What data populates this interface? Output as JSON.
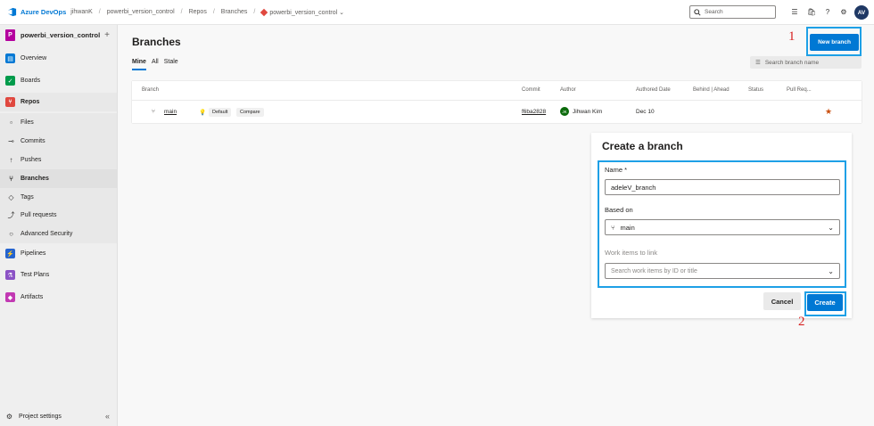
{
  "topbar": {
    "brand": "Azure DevOps",
    "org": "jihwanK",
    "project": "powerbi_version_control",
    "repos": "Repos",
    "branches": "Branches",
    "repo_name": "powerbi_version_control",
    "search_placeholder": "Search",
    "avatar_initials": "AV"
  },
  "sidebar": {
    "project_badge": "P",
    "project_name": "powerbi_version_control",
    "items": [
      {
        "label": "Overview"
      },
      {
        "label": "Boards"
      },
      {
        "label": "Repos"
      },
      {
        "label": "Files"
      },
      {
        "label": "Commits"
      },
      {
        "label": "Pushes"
      },
      {
        "label": "Branches"
      },
      {
        "label": "Tags"
      },
      {
        "label": "Pull requests"
      },
      {
        "label": "Advanced Security"
      },
      {
        "label": "Pipelines"
      },
      {
        "label": "Test Plans"
      },
      {
        "label": "Artifacts"
      }
    ],
    "settings_label": "Project settings"
  },
  "main": {
    "title": "Branches",
    "tabs": [
      "Mine",
      "All",
      "Stale"
    ],
    "filter_placeholder": "Search branch name",
    "new_branch_label": "New branch",
    "annotation_1": "1",
    "annotation_2": "2",
    "table": {
      "columns": [
        "Branch",
        "Commit",
        "Author",
        "Authored Date",
        "Behind | Ahead",
        "Status",
        "Pull Req..."
      ],
      "rows": [
        {
          "branch": "main",
          "default_tag": "Default",
          "compare_tag": "Compare",
          "commit": "f6ba2828",
          "author": "Jihwan Kim",
          "author_initials": "JK",
          "date": "Dec 10"
        }
      ]
    }
  },
  "create_branch": {
    "title": "Create a branch",
    "name_label": "Name *",
    "name_value": "adeleV_branch",
    "based_on_label": "Based on",
    "based_on_value": "main",
    "work_items_label": "Work items to link",
    "work_items_placeholder": "Search work items by ID or title",
    "cancel_label": "Cancel",
    "create_label": "Create"
  },
  "colors": {
    "accent": "#0078d4",
    "highlight_frame": "#1ea0e6",
    "annotation": "#d62020",
    "project_badge": "#b4009e"
  }
}
